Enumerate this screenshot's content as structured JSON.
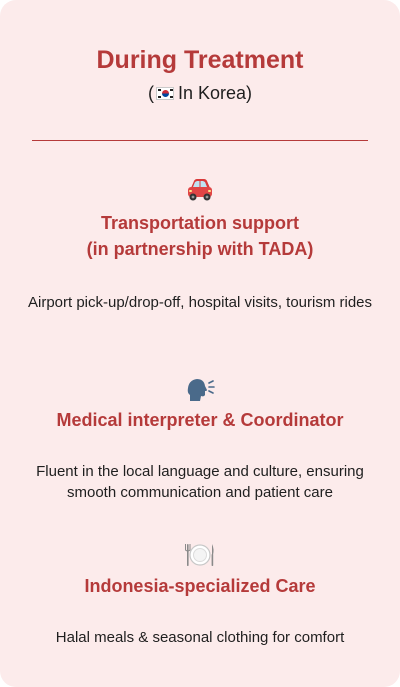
{
  "header": {
    "title": "During Treatment",
    "subtitle_open": "(",
    "subtitle_text": "In Korea)"
  },
  "sections": [
    {
      "icon": "car-icon",
      "title_line1": "Transportation support",
      "title_line2": "(in partnership with TADA)",
      "description": "Airport pick-up/drop-off, hospital visits, tourism rides"
    },
    {
      "icon": "speaking-head-icon",
      "title_line1": "Medical interpreter & Coordinator",
      "description": "Fluent in the local language and culture, ensuring smooth communication and patient care"
    },
    {
      "icon": "plate-cutlery-icon",
      "title_line1": "Indonesia-specialized Care",
      "description": "Halal meals & seasonal clothing for comfort"
    }
  ],
  "colors": {
    "background": "#fcebeb",
    "accent": "#b53a3a",
    "text": "#1f1f1f"
  }
}
